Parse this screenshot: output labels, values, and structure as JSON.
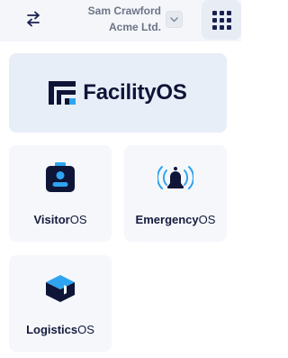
{
  "header": {
    "user_name": "Sam Crawford",
    "org_name": "Acme Ltd."
  },
  "brand": {
    "name": "FacilityOS"
  },
  "apps": [
    {
      "name_bold": "Visitor",
      "name_suffix": "OS",
      "icon": "visitor-badge-icon"
    },
    {
      "name_bold": "Emergency",
      "name_suffix": "OS",
      "icon": "alarm-bell-icon"
    },
    {
      "name_bold": "Logistics",
      "name_suffix": "OS",
      "icon": "package-box-icon"
    }
  ],
  "colors": {
    "brand_navy": "#0e1537",
    "accent_blue": "#2fa4f0",
    "topbar_bg": "#f4f6fa",
    "card_bg": "#f5f7fa",
    "brand_card_bg": "#e8eef8"
  }
}
